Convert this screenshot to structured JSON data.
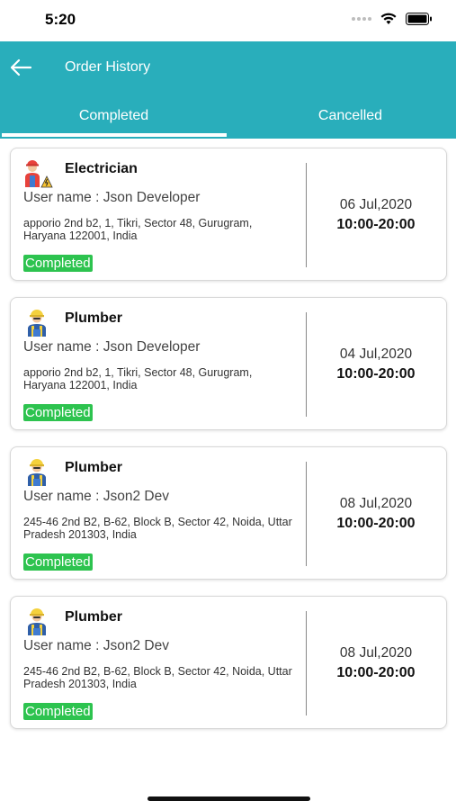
{
  "status_bar": {
    "time": "5:20"
  },
  "header": {
    "title": "Order History"
  },
  "tabs": [
    {
      "label": "Completed"
    },
    {
      "label": "Cancelled"
    }
  ],
  "orders": [
    {
      "service": "Electrician",
      "avatar_icon": "electrician-icon",
      "username": "User name : Json Developer",
      "address": "apporio 2nd b2, 1, Tikri, Sector 48, Gurugram, Haryana 122001, India",
      "status": "Completed",
      "date": "06 Jul,2020",
      "time": "10:00-20:00"
    },
    {
      "service": "Plumber",
      "avatar_icon": "plumber-icon",
      "username": "User name : Json Developer",
      "address": "apporio 2nd b2, 1, Tikri, Sector 48, Gurugram, Haryana 122001, India",
      "status": "Completed",
      "date": "04 Jul,2020",
      "time": "10:00-20:00"
    },
    {
      "service": "Plumber",
      "avatar_icon": "plumber-icon",
      "username": "User name : Json2 Dev",
      "address": "245-46 2nd B2, B-62, Block B, Sector 42, Noida, Uttar Pradesh 201303, India",
      "status": "Completed",
      "date": "08 Jul,2020",
      "time": "10:00-20:00"
    },
    {
      "service": "Plumber",
      "avatar_icon": "plumber-icon",
      "username": "User name : Json2 Dev",
      "address": "245-46 2nd B2, B-62, Block B, Sector 42, Noida, Uttar Pradesh 201303, India",
      "status": "Completed",
      "date": "08 Jul,2020",
      "time": "10:00-20:00"
    }
  ],
  "colors": {
    "header": "#29aebb",
    "status_badge": "#2dc34f"
  }
}
